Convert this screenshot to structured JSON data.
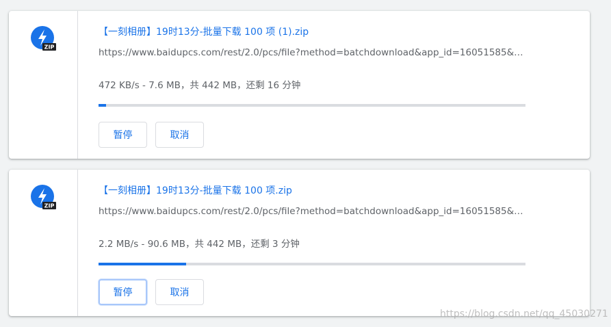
{
  "colors": {
    "accent": "#1a73e8",
    "text_secondary": "#5f6368",
    "track": "#dadce0",
    "background": "#f1f3f4"
  },
  "downloads": [
    {
      "icon": "zip-file-icon",
      "icon_label": "ZIP",
      "file_name": "【一刻相册】19时13分-批量下载 100 项 (1).zip",
      "url": "https://www.baidupcs.com/rest/2.0/pcs/file?method=batchdownload&app_id=16051585&…",
      "status": "472 KB/s - 7.6 MB，共 442 MB，还剩 16 分钟",
      "progress_percent": 1.7,
      "pause_label": "暂停",
      "cancel_label": "取消"
    },
    {
      "icon": "zip-file-icon",
      "icon_label": "ZIP",
      "file_name": "【一刻相册】19时13分-批量下载 100 项.zip",
      "url": "https://www.baidupcs.com/rest/2.0/pcs/file?method=batchdownload&app_id=16051585&…",
      "status": "2.2 MB/s - 90.6 MB，共 442 MB，还剩 3 分钟",
      "progress_percent": 20.5,
      "pause_label": "暂停",
      "cancel_label": "取消"
    }
  ],
  "watermark": "https://blog.csdn.net/qq_45030271"
}
